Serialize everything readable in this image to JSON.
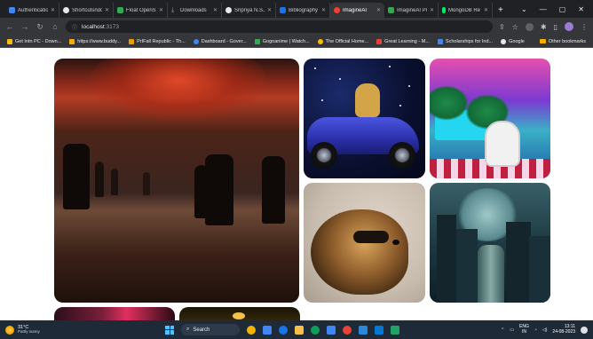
{
  "browser": {
    "tabs": [
      {
        "label": "Authenticatio",
        "color": "#4285f4",
        "active": false
      },
      {
        "label": "Shortcutsndo",
        "color": "#e8eaed",
        "active": false
      },
      {
        "label": "Float OpenS",
        "color": "#34a853",
        "active": false
      },
      {
        "label": "Downloads",
        "color": "#9aa0a6",
        "active": false
      },
      {
        "label": "Sripriya N.S./",
        "color": "#e8eaed",
        "active": false
      },
      {
        "label": "Bibliography",
        "color": "#1a73e8",
        "active": false
      },
      {
        "label": "ImagineAI",
        "color": "#ea4335",
        "active": true
      },
      {
        "label": "ImagineAI Pro",
        "color": "#34a853",
        "active": false
      },
      {
        "label": "MongoDB Re",
        "color": "#00ed64",
        "active": false
      }
    ],
    "new_tab_symbol": "+",
    "window_controls": {
      "minimize": "—",
      "maximize": "▢",
      "close": "✕"
    },
    "address": {
      "host": "localhost",
      "port": ":3173"
    },
    "bookmarks": [
      {
        "label": "Get Intn PC - Down...",
        "color": "#fbbc04"
      },
      {
        "label": "https://www.buddy...",
        "color": "#f9ab00"
      },
      {
        "label": "PrIFall Republic - Th...",
        "color": "#f29900"
      },
      {
        "label": "Dashboard - Gover...",
        "color": "#4285f4"
      },
      {
        "label": "Gogoanime | Watch...",
        "color": "#34a853"
      },
      {
        "label": "The Official Home...",
        "color": "#fbbc04"
      },
      {
        "label": "Great Learning - M...",
        "color": "#ea4335"
      },
      {
        "label": "Scholarships for Ind...",
        "color": "#4285f4"
      },
      {
        "label": "Google",
        "color": "#e8eaed"
      }
    ],
    "other_bookmarks": "Other bookmarks"
  },
  "gallery": {
    "images": [
      {
        "name": "dusk-silhouettes"
      },
      {
        "name": "cat-in-car"
      },
      {
        "name": "astronaut-poolside"
      },
      {
        "name": "raccoon"
      },
      {
        "name": "gothic-ruins"
      },
      {
        "name": "neon-scene"
      },
      {
        "name": "golden-interior"
      }
    ]
  },
  "taskbar": {
    "weather": {
      "temp": "31°C",
      "condition": "Partly sunny"
    },
    "search_label": "Search",
    "apps": [
      "#f4b400",
      "#4285f4",
      "#1a73e8",
      "#f6c04a",
      "#0f9d58",
      "#4285f4",
      "#ea4335",
      "#2b88d8",
      "#0078d4",
      "#21a366"
    ],
    "language": {
      "line1": "ENG",
      "line2": "IN"
    },
    "clock": {
      "time": "13:11",
      "date": "24-08-2023"
    }
  }
}
